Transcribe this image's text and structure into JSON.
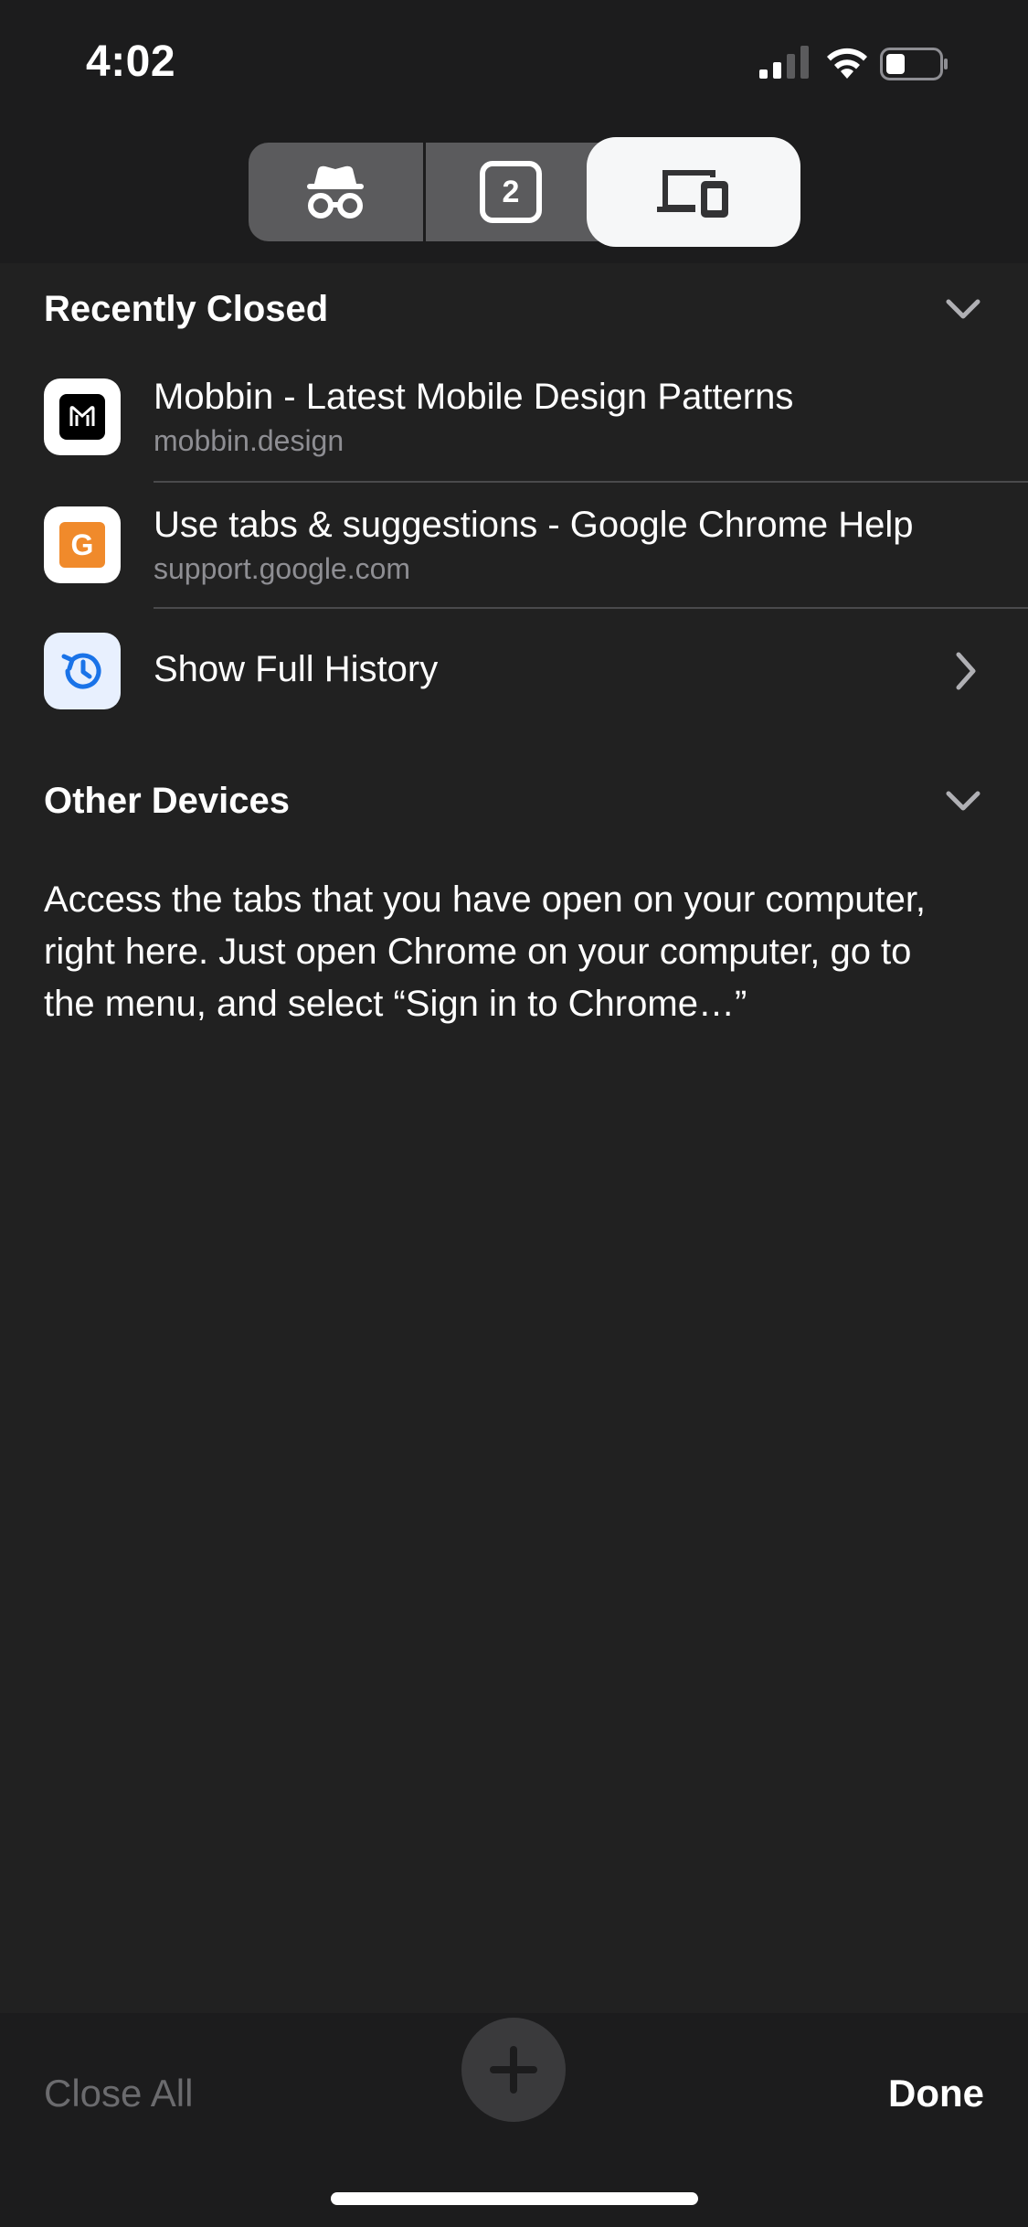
{
  "status_bar": {
    "time": "4:02"
  },
  "tab_switcher": {
    "open_tab_count": "2",
    "selected": "other-devices"
  },
  "recently_closed": {
    "title": "Recently Closed",
    "items": [
      {
        "title": "Mobbin - Latest Mobile Design Patterns",
        "subtitle": "mobbin.design",
        "icon": "mobbin-favicon"
      },
      {
        "title": "Use tabs & suggestions - Google Chrome Help",
        "subtitle": "support.google.com",
        "icon": "google-favicon",
        "icon_letter": "G"
      }
    ],
    "history_label": "Show Full History"
  },
  "other_devices": {
    "title": "Other Devices",
    "message": "Access the tabs that you have open on your computer, right here. Just open Chrome on your computer, go to the menu, and select “Sign in to Chrome…”"
  },
  "toolbar": {
    "close_all_label": "Close All",
    "done_label": "Done"
  },
  "colors": {
    "background": "#212121",
    "bar": "#1c1c1d",
    "google_orange": "#f08a2b",
    "history_blue": "#1a73e8"
  }
}
